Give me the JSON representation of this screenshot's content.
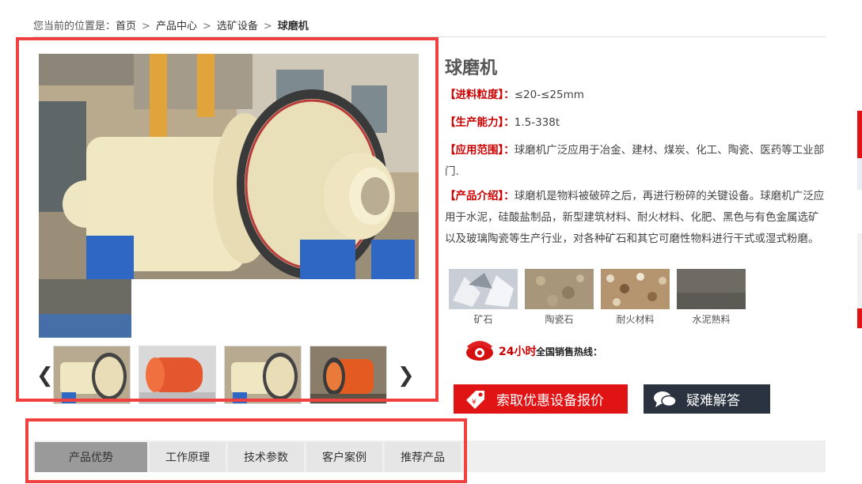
{
  "breadcrumb": {
    "prefix": "您当前的位置是：",
    "items": [
      "首页",
      "产品中心",
      "选矿设备"
    ],
    "separator": ">",
    "current": "球磨机"
  },
  "product": {
    "title": "球磨机",
    "specs": [
      {
        "label": "【进料粒度】",
        "colon": "：",
        "value": "≤20-≤25mm"
      },
      {
        "label": "【生产能力】",
        "colon": "：",
        "value": "1.5-338t"
      },
      {
        "label": "【应用范围】",
        "colon": "：",
        "value": "球磨机广泛应用于冶金、建材、煤炭、化工、陶瓷、医药等工业部门."
      },
      {
        "label": "【产品介绍】",
        "colon": "：",
        "value": "球磨机是物料被破碎之后，再进行粉碎的关键设备。球磨机广泛应用于水泥，硅酸盐制品，新型建筑材料、耐火材料、化肥、黑色与有色金属选矿以及玻璃陶瓷等生产行业，对各种矿石和其它可磨性物料进行干式或湿式粉磨。"
      }
    ]
  },
  "gallery": {
    "prev_arrow": "❮",
    "next_arrow": "❯",
    "thumb_count": 4
  },
  "materials": [
    {
      "name": "矿石",
      "color": "#c9cdd6"
    },
    {
      "name": "陶瓷石",
      "color": "#a8967a"
    },
    {
      "name": "耐火材料",
      "color": "#b59570"
    },
    {
      "name": "水泥熟料",
      "color": "#6d6b64"
    }
  ],
  "hotline": {
    "hours": "24小时",
    "label": "全国销售热线："
  },
  "buttons": {
    "quote": "索取优惠设备报价",
    "faq": "疑难解答"
  },
  "tabs": [
    "产品优势",
    "工作原理",
    "技术参数",
    "客户案例",
    "推荐产品"
  ],
  "colors": {
    "accent_red": "#e01414",
    "dark_button": "#2b3240",
    "highlight_box": "#f04040",
    "label_red": "#cc0000"
  }
}
